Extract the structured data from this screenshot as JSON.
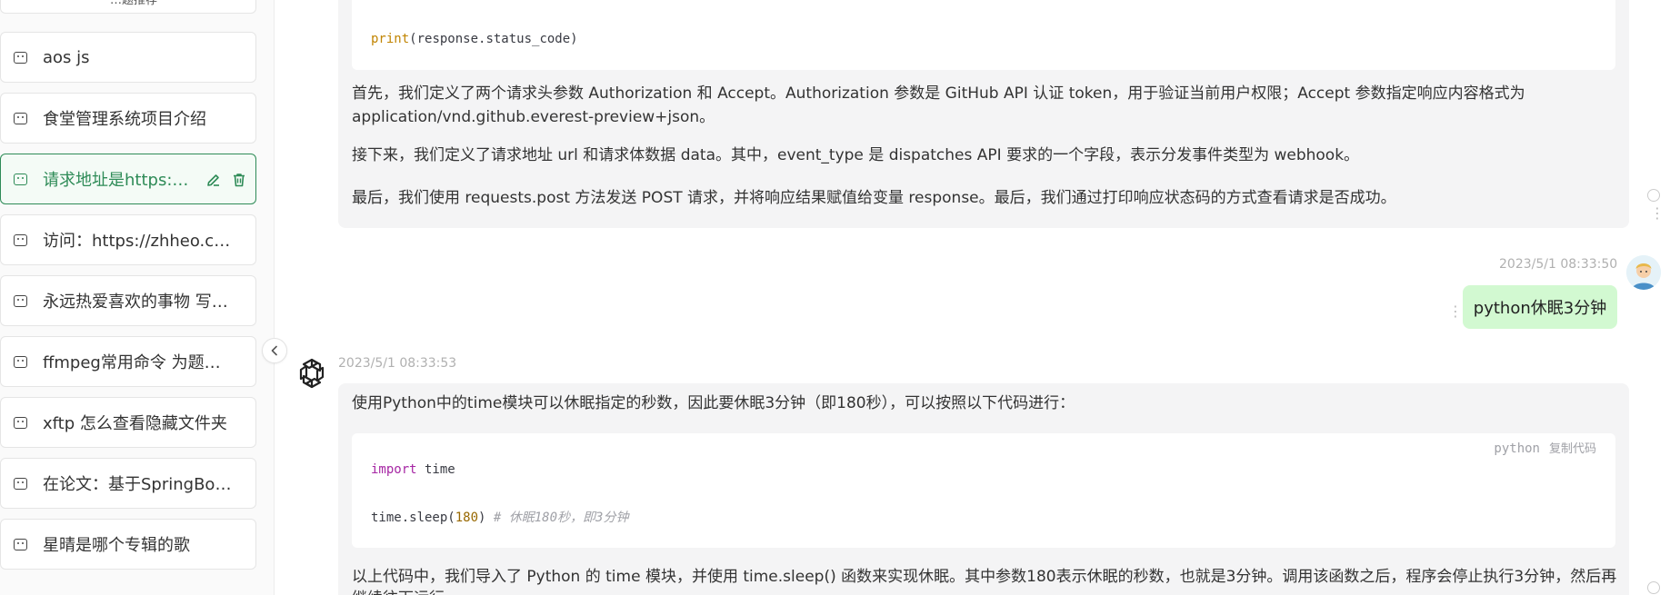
{
  "sidebar": {
    "top_stub_label": "…题推荐",
    "items": [
      {
        "label": "aos js"
      },
      {
        "label": "食堂管理系统项目介绍"
      },
      {
        "label": "请求地址是https://api.github.com/repos/zhheo/..."
      },
      {
        "label": "访问：https://zhheo.com/"
      },
      {
        "label": "永远热爱喜欢的事物 写有关这个题目的文章"
      },
      {
        "label": "ffmpeg常用命令 为题写一篇文章"
      },
      {
        "label": "xftp 怎么查看隐藏文件夹"
      },
      {
        "label": "在论文：基于SpringBoot的食堂管理系统"
      },
      {
        "label": "星晴是哪个专辑的歌"
      }
    ]
  },
  "messages": {
    "first": {
      "code_print": "print",
      "code_arg": "(response.status_code)",
      "p1a": "首先，我们定义了两个请求头参数 Authorization 和 Accept。Authorization 参数是 GitHub API 认证 token，用于验证当前用户权限；Accept 参数指定响应内容格式为",
      "p1b": "application/vnd.github.everest-preview+json。",
      "p2": "接下来，我们定义了请求地址 url 和请求体数据 data。其中，event_type 是 dispatches API 要求的一个字段，表示分发事件类型为 webhook。",
      "p3": "最后，我们使用 requests.post 方法发送 POST 请求，并将响应结果赋值给变量 response。最后，我们通过打印响应状态码的方式查看请求是否成功。"
    },
    "user": {
      "timestamp": "2023/5/1 08:33:50",
      "text": "python休眠3分钟"
    },
    "bot": {
      "timestamp": "2023/5/1 08:33:53",
      "intro": "使用Python中的time模块可以休眠指定的秒数，因此要休眠3分钟（即180秒），可以按照以下代码进行：",
      "code_lang": "python",
      "copy_label": "复制代码",
      "code_import_kw": "import",
      "code_import_mod": " time",
      "code_call": "time.sleep(",
      "code_num": "180",
      "code_close": ")",
      "code_comment": " # 休眠180秒，即3分钟",
      "outro": "以上代码中，我们导入了 Python 的 time 模块，并使用 time.sleep() 函数来实现休眠。其中参数180表示休眠的秒数，也就是3分钟。调用该函数之后，程序会停止执行3分钟，然后再",
      "outro2": "继续往下运行。"
    }
  },
  "colors": {
    "accent": "#2e8b57",
    "user_bubble": "#d2f9d1",
    "bot_bubble": "#f4f4f5"
  }
}
